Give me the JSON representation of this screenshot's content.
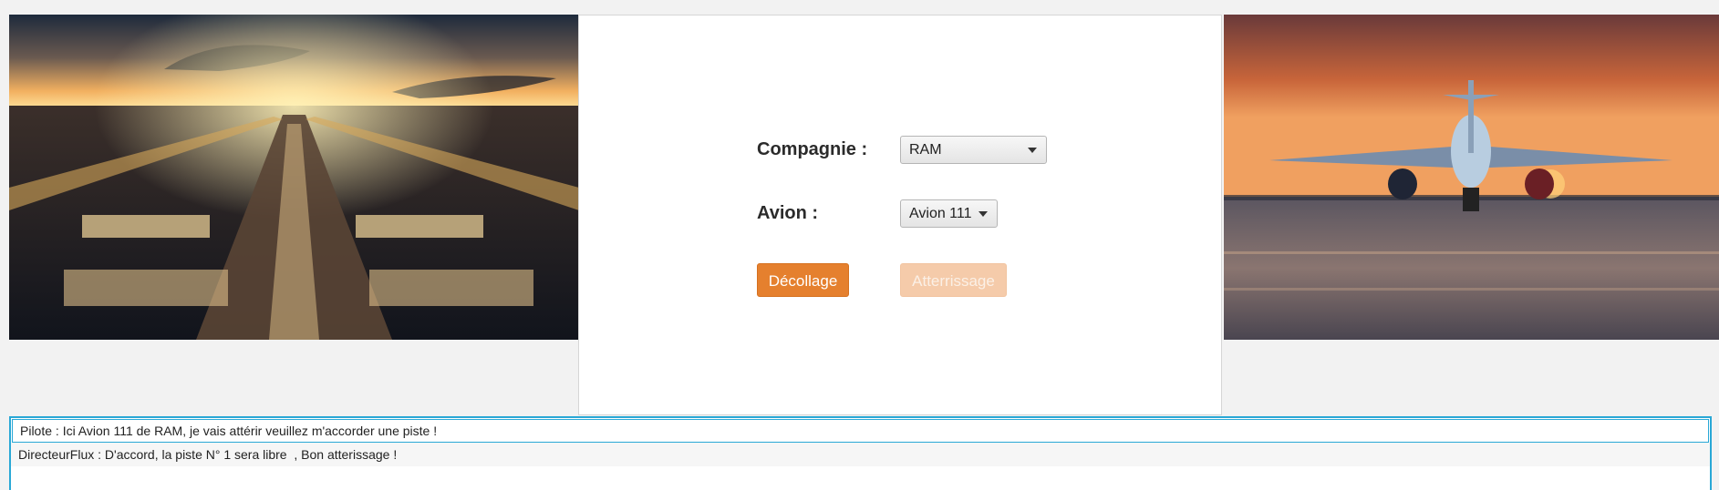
{
  "images": {
    "left": {
      "description_icon": "runway-sunset-image"
    },
    "right": {
      "description_icon": "airplane-runway-sunset-image"
    }
  },
  "form": {
    "company_label": "Compagnie :",
    "company_value": "RAM",
    "plane_label": "Avion :",
    "plane_value": "Avion 111",
    "takeoff_label": "Décollage",
    "landing_label": "Atterrissage"
  },
  "log": {
    "lines": [
      "Pilote : Ici Avion 111 de RAM, je vais attérir veuillez m'accorder une piste !",
      "DirecteurFlux : D'accord, la piste N° 1 sera libre  , Bon atterissage !"
    ]
  },
  "colors": {
    "accent": "#e5802e",
    "accent_disabled": "#f5cbaa",
    "selection_border": "#29a8d6"
  }
}
